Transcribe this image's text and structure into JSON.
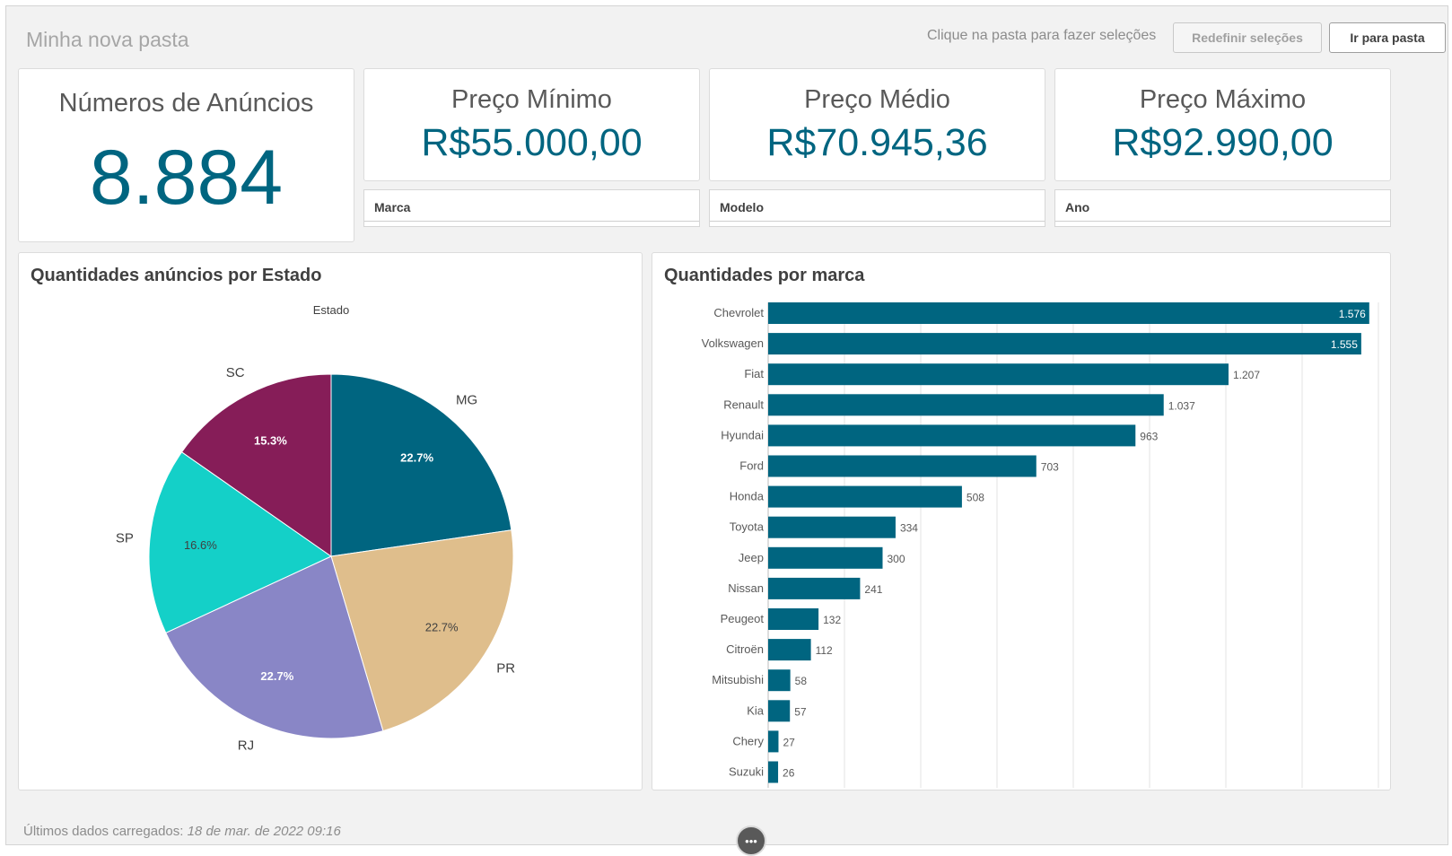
{
  "header": {
    "title": "Minha nova pasta",
    "hint": "Clique na pasta para fazer seleções",
    "reset_label": "Redefinir seleções",
    "go_label": "Ir para pasta"
  },
  "kpis": {
    "count": {
      "label": "Números de Anúncios",
      "value": "8.884"
    },
    "min": {
      "label": "Preço Mínimo",
      "value": "R$55.000,00"
    },
    "avg": {
      "label": "Preço Médio",
      "value": "R$70.945,36"
    },
    "max": {
      "label": "Preço Máximo",
      "value": "R$92.990,00"
    }
  },
  "filters": {
    "brand": "Marca",
    "model": "Modelo",
    "year": "Ano"
  },
  "pie_title": "Quantidades anúncios por Estado",
  "bar_title": "Quantidades por marca",
  "footer": {
    "label": "Últimos dados carregados:",
    "timestamp": "18 de mar. de 2022 09:16"
  },
  "more_icon": "ellipsis-icon",
  "colors": {
    "accent": "#006580",
    "MG": "#006580",
    "PR": "#dfbe8c",
    "RJ": "#8986c6",
    "SP": "#14d0c8",
    "SC": "#861d58"
  },
  "chart_data": [
    {
      "type": "pie",
      "title": "Quantidades anúncios por Estado",
      "legend_title": "Estado",
      "slices": [
        {
          "label": "MG",
          "value": 22.7,
          "display": "22.7%"
        },
        {
          "label": "PR",
          "value": 22.7,
          "display": "22.7%"
        },
        {
          "label": "RJ",
          "value": 22.7,
          "display": "22.7%"
        },
        {
          "label": "SP",
          "value": 16.6,
          "display": "16.6%"
        },
        {
          "label": "SC",
          "value": 15.3,
          "display": "15.3%"
        }
      ]
    },
    {
      "type": "bar",
      "orientation": "horizontal",
      "title": "Quantidades por marca",
      "categories": [
        "Chevrolet",
        "Volkswagen",
        "Fiat",
        "Renault",
        "Hyundai",
        "Ford",
        "Honda",
        "Toyota",
        "Jeep",
        "Nissan",
        "Peugeot",
        "Citroën",
        "Mitsubishi",
        "Kia",
        "Chery",
        "Suzuki"
      ],
      "values": [
        1576,
        1555,
        1207,
        1037,
        963,
        703,
        508,
        334,
        300,
        241,
        132,
        112,
        58,
        57,
        27,
        26
      ],
      "value_labels": [
        "1.576",
        "1.555",
        "1.207",
        "1.037",
        "963",
        "703",
        "508",
        "334",
        "300",
        "241",
        "132",
        "112",
        "58",
        "57",
        "27",
        "26"
      ],
      "xlim": [
        0,
        1600
      ],
      "grid": true,
      "color": "#006580"
    }
  ]
}
